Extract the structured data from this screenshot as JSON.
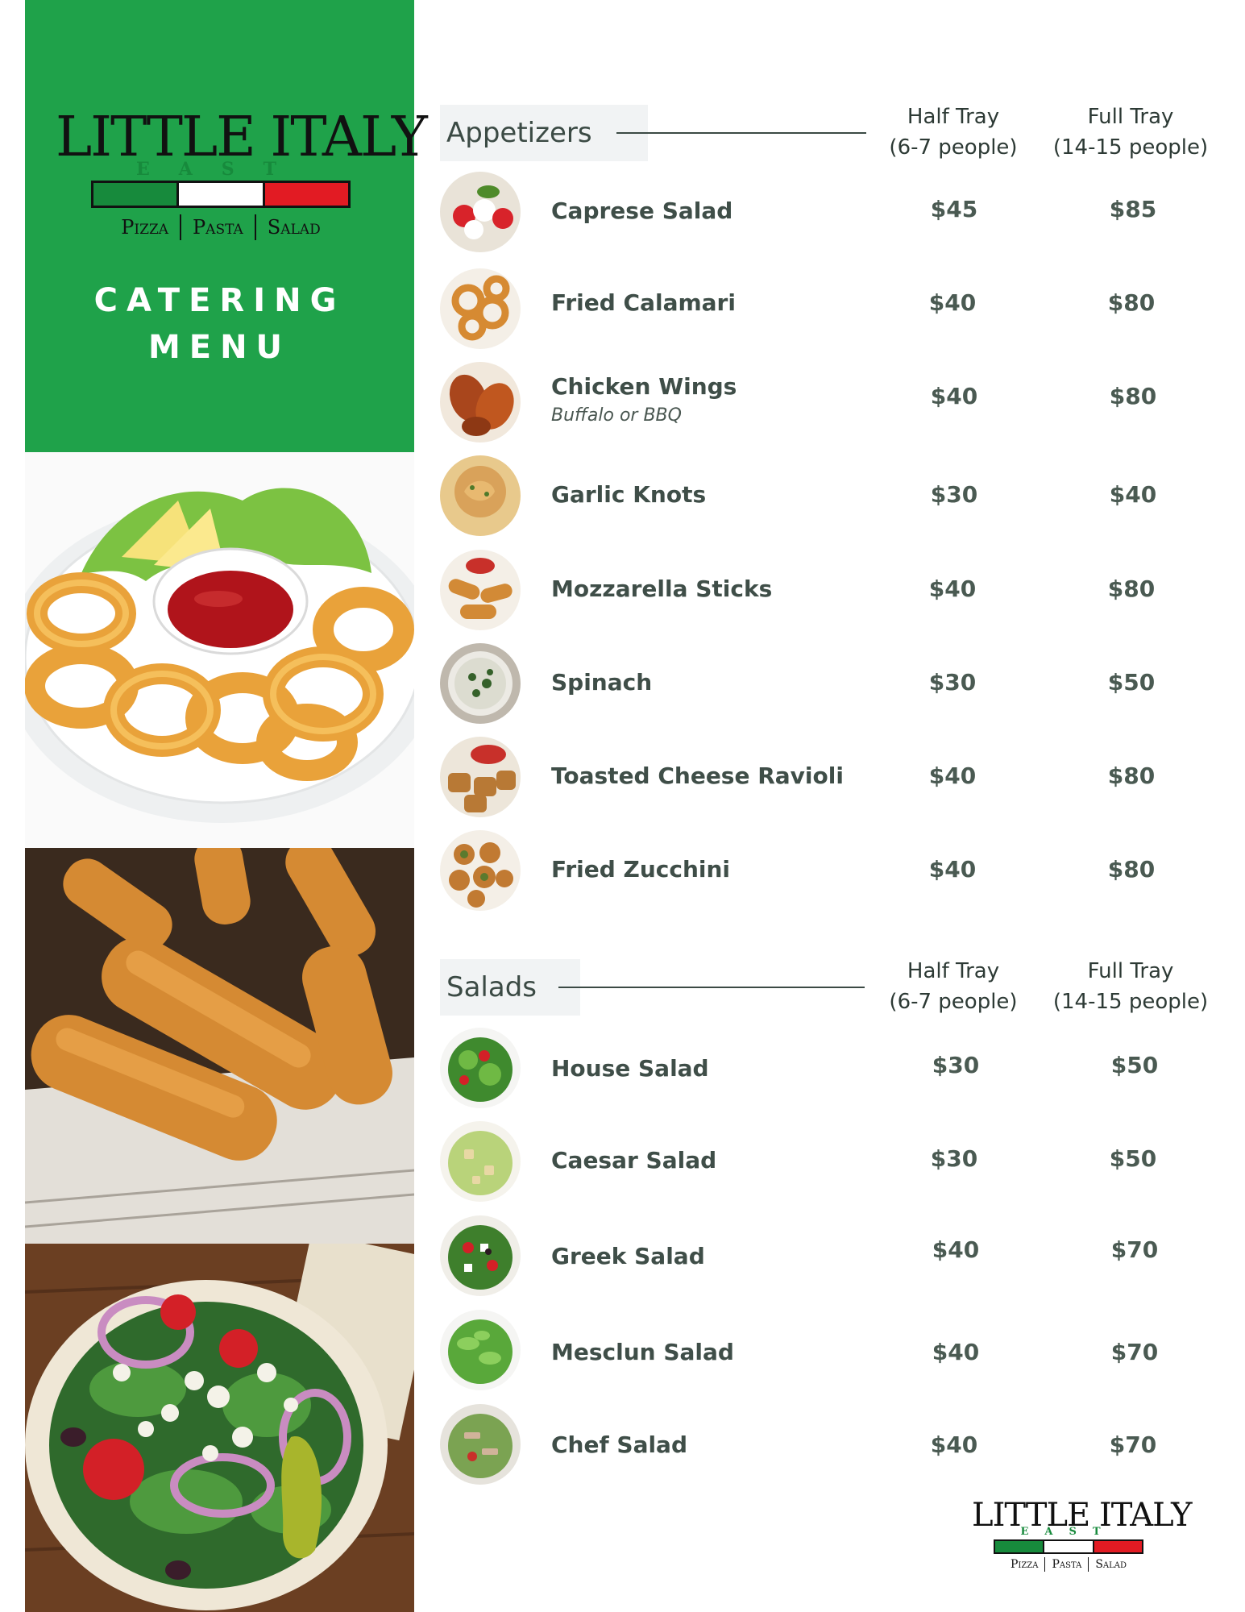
{
  "brand": {
    "name": "LITTLE ITALY",
    "sub": "EAST",
    "tag": [
      "Pizza",
      "Pasta",
      "Salad"
    ],
    "colors": {
      "green": "#178a3c",
      "white": "#ffffff",
      "red": "#e21b23",
      "panel": "#1fa24a"
    }
  },
  "cover": {
    "line1": "CATERING",
    "line2": "MENU"
  },
  "photos": [
    "fried-calamari-photo",
    "mozzarella-sticks-photo",
    "greek-salad-photo"
  ],
  "appetizers": {
    "title": "Appetizers",
    "half_label": "Half Tray",
    "half_sub": "(6-7 people)",
    "full_label": "Full Tray",
    "full_sub": "(14-15 people)",
    "items": [
      {
        "name": "Caprese Salad",
        "sub": "",
        "half": "$45",
        "full": "$85"
      },
      {
        "name": "Fried Calamari",
        "sub": "",
        "half": "$40",
        "full": "$80"
      },
      {
        "name": "Chicken Wings",
        "sub": "Buffalo or BBQ",
        "half": "$40",
        "full": "$80"
      },
      {
        "name": "Garlic Knots",
        "sub": "",
        "half": "$30",
        "full": "$40"
      },
      {
        "name": "Mozzarella Sticks",
        "sub": "",
        "half": "$40",
        "full": "$80"
      },
      {
        "name": "Spinach",
        "sub": "",
        "half": "$30",
        "full": "$50"
      },
      {
        "name": "Toasted Cheese Ravioli",
        "sub": "",
        "half": "$40",
        "full": "$80"
      },
      {
        "name": "Fried Zucchini",
        "sub": "",
        "half": "$40",
        "full": "$80"
      }
    ]
  },
  "salads": {
    "title": "Salads",
    "half_label": "Half Tray",
    "half_sub": "(6-7 people)",
    "full_label": "Full Tray",
    "full_sub": "(14-15 people)",
    "items": [
      {
        "name": "House Salad",
        "half": "$30",
        "full": "$50"
      },
      {
        "name": "Caesar Salad",
        "half": "$30",
        "full": "$50"
      },
      {
        "name": "Greek Salad",
        "half": "$40",
        "full": "$70"
      },
      {
        "name": "Mesclun Salad",
        "half": "$40",
        "full": "$70"
      },
      {
        "name": "Chef Salad",
        "half": "$40",
        "full": "$70"
      }
    ]
  }
}
